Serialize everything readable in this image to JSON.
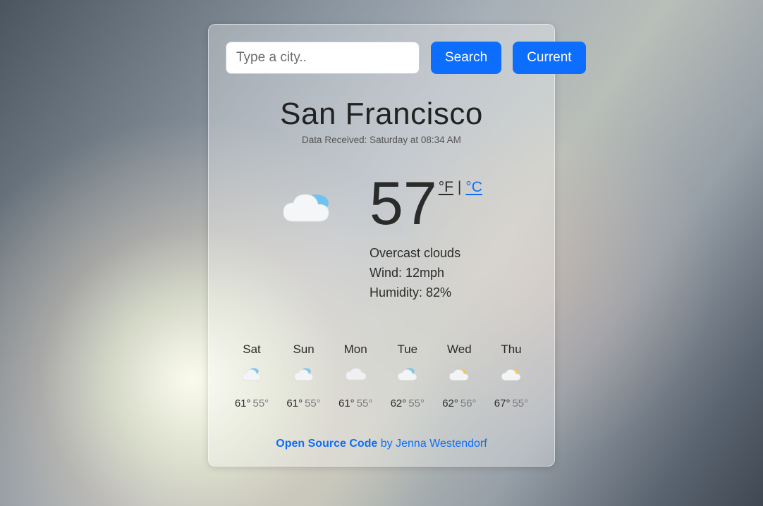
{
  "search": {
    "placeholder": "Type a city..",
    "search_label": "Search",
    "current_label": "Current"
  },
  "header": {
    "city": "San Francisco",
    "data_received": "Data Received: Saturday at 08:34 AM"
  },
  "current": {
    "temp": "57",
    "unit_f": "°F",
    "unit_sep": " | ",
    "unit_c": "°C",
    "description": "Overcast clouds",
    "wind": "Wind: 12mph",
    "humidity": "Humidity: 82%",
    "icon": "cloud-overcast"
  },
  "forecast": [
    {
      "day": "Sat",
      "icon": "cloud-overcast",
      "hi": "61°",
      "lo": "55°"
    },
    {
      "day": "Sun",
      "icon": "cloud-overcast",
      "hi": "61°",
      "lo": "55°"
    },
    {
      "day": "Mon",
      "icon": "cloud",
      "hi": "61°",
      "lo": "55°"
    },
    {
      "day": "Tue",
      "icon": "cloud-overcast",
      "hi": "62°",
      "lo": "55°"
    },
    {
      "day": "Wed",
      "icon": "cloud-sun",
      "hi": "62°",
      "lo": "56°"
    },
    {
      "day": "Thu",
      "icon": "cloud-sun",
      "hi": "67°",
      "lo": "55°"
    }
  ],
  "footer": {
    "link_text": "Open Source Code",
    "by_text": " by Jenna Westendorf"
  }
}
